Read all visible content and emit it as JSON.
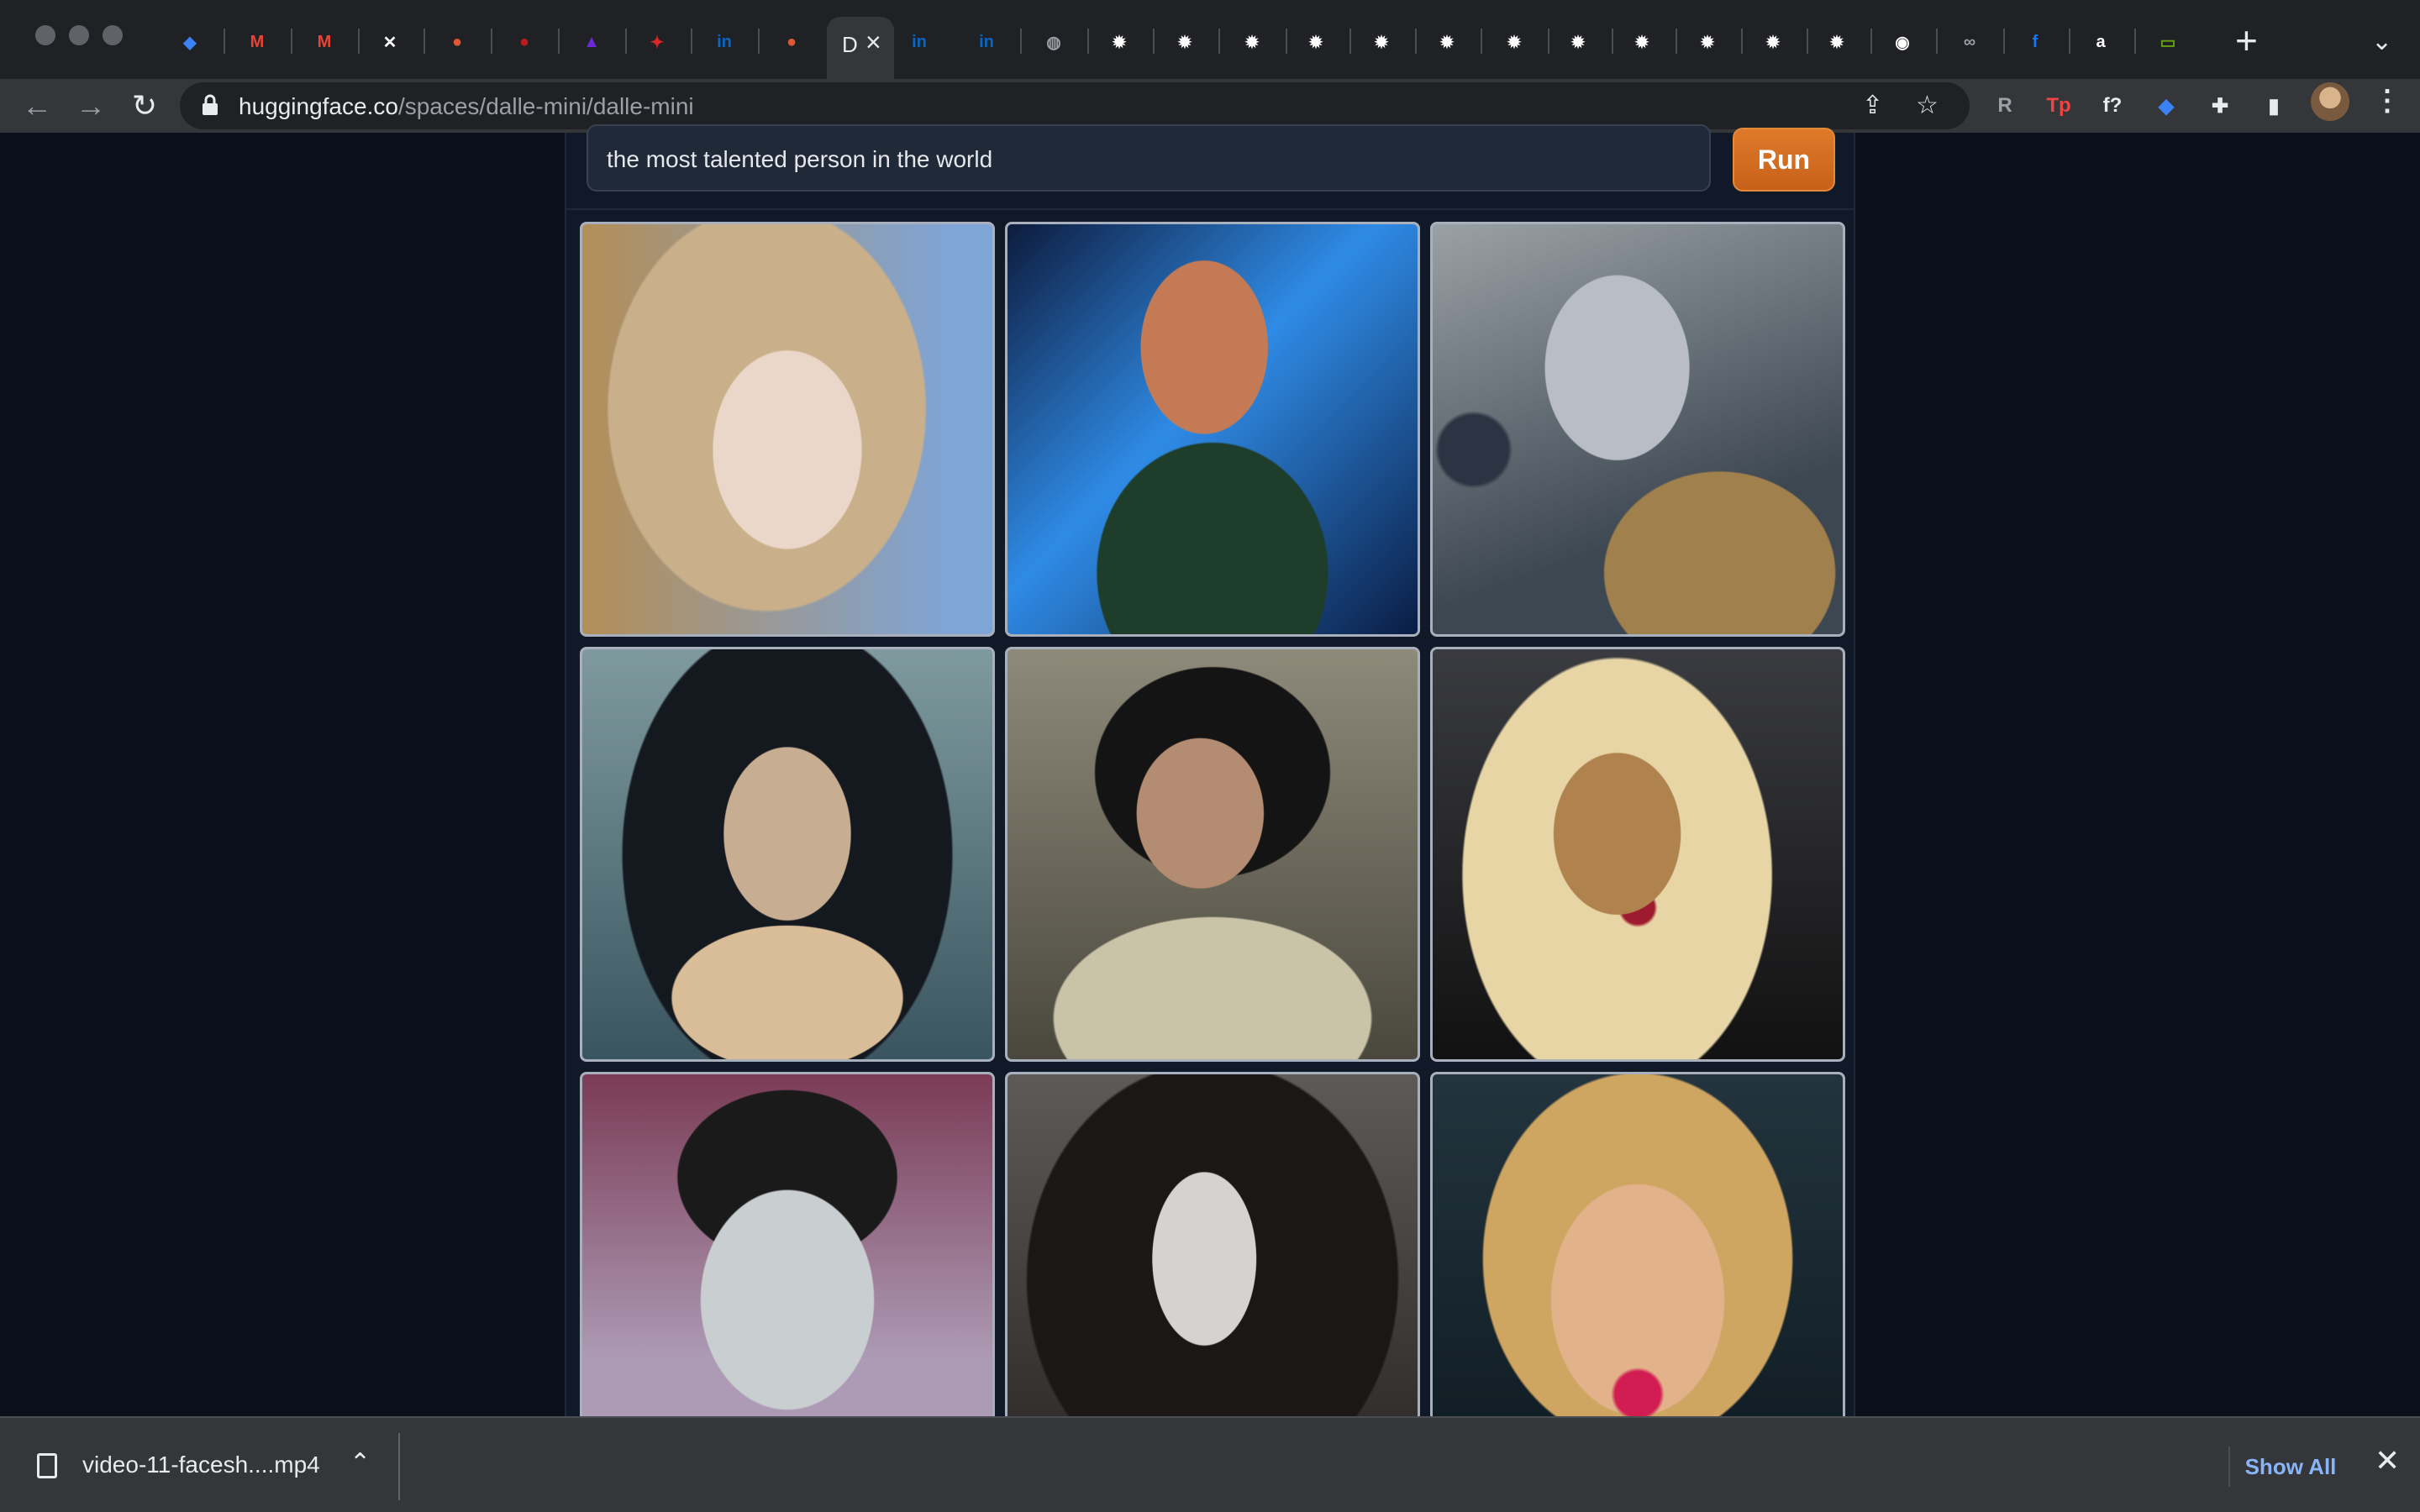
{
  "browser": {
    "url_host": "huggingface.co",
    "url_path": "/spaces/dalle-mini/dalle-mini",
    "active_tab_glyph": "D",
    "tabs": [
      {
        "icon": "gem-icon",
        "glyph": "◆",
        "color": "#3b82f6"
      },
      {
        "icon": "gmail-icon",
        "glyph": "M",
        "color": "#ea4335"
      },
      {
        "icon": "gmail-icon",
        "glyph": "M",
        "color": "#ea4335"
      },
      {
        "icon": "app-icon",
        "glyph": "✕",
        "color": "#ffffff"
      },
      {
        "icon": "duckduckgo-icon",
        "glyph": "●",
        "color": "#de5833"
      },
      {
        "icon": "record-icon",
        "glyph": "●",
        "color": "#b91c1c"
      },
      {
        "icon": "purple-app-icon",
        "glyph": "▲",
        "color": "#6d28d9"
      },
      {
        "icon": "red-app-icon",
        "glyph": "✦",
        "color": "#dc2626"
      },
      {
        "icon": "linkedin-icon",
        "glyph": "in",
        "color": "#0a66c2"
      },
      {
        "icon": "duckduckgo-icon",
        "glyph": "●",
        "color": "#de5833"
      },
      {
        "icon": "linkedin-icon",
        "glyph": "in",
        "color": "#0a66c2"
      },
      {
        "icon": "linkedin-icon",
        "glyph": "in",
        "color": "#0a66c2"
      },
      {
        "icon": "globe-icon",
        "glyph": "◍",
        "color": "#9aa0a6"
      },
      {
        "icon": "gear-icon",
        "glyph": "✹",
        "color": "#ffffff"
      },
      {
        "icon": "gear-icon",
        "glyph": "✹",
        "color": "#ffffff"
      },
      {
        "icon": "gear-icon",
        "glyph": "✹",
        "color": "#ffffff"
      },
      {
        "icon": "gear-icon",
        "glyph": "✹",
        "color": "#ffffff"
      },
      {
        "icon": "gear-icon",
        "glyph": "✹",
        "color": "#ffffff"
      },
      {
        "icon": "gear-icon",
        "glyph": "✹",
        "color": "#ffffff"
      },
      {
        "icon": "gear-icon",
        "glyph": "✹",
        "color": "#ffffff"
      },
      {
        "icon": "gear-icon",
        "glyph": "✹",
        "color": "#ffffff"
      },
      {
        "icon": "gear-icon",
        "glyph": "✹",
        "color": "#ffffff"
      },
      {
        "icon": "gear-icon",
        "glyph": "✹",
        "color": "#ffffff"
      },
      {
        "icon": "gear-icon",
        "glyph": "✹",
        "color": "#ffffff"
      },
      {
        "icon": "gear-icon",
        "glyph": "✹",
        "color": "#ffffff"
      },
      {
        "icon": "github-icon",
        "glyph": "◉",
        "color": "#ffffff"
      },
      {
        "icon": "infinity-icon",
        "glyph": "∞",
        "color": "#9aa0a6"
      },
      {
        "icon": "facebook-icon",
        "glyph": "f",
        "color": "#1877f2"
      },
      {
        "icon": "amazon-icon",
        "glyph": "a",
        "color": "#ffffff"
      },
      {
        "icon": "battery-icon",
        "glyph": "▭",
        "color": "#65a30d"
      }
    ],
    "extensions": [
      {
        "icon": "r-extension-icon",
        "glyph": "R",
        "color": "#9aa0a6"
      },
      {
        "icon": "tp-extension-icon",
        "glyph": "Tp",
        "color": "#ef4444"
      },
      {
        "icon": "formula-extension-icon",
        "glyph": "f?",
        "color": "#e8eaed"
      },
      {
        "icon": "gem-extension-icon",
        "glyph": "◆",
        "color": "#3b82f6"
      },
      {
        "icon": "puzzle-icon",
        "glyph": "✚",
        "color": "#e8eaed"
      },
      {
        "icon": "sidepanel-icon",
        "glyph": "▮",
        "color": "#e8eaed"
      }
    ]
  },
  "app": {
    "prompt_value": "the most talented person in the world",
    "run_label": "Run",
    "images": [
      "generated-image-1",
      "generated-image-2",
      "generated-image-3",
      "generated-image-4",
      "generated-image-5",
      "generated-image-6",
      "generated-image-7",
      "generated-image-8",
      "generated-image-9"
    ]
  },
  "download": {
    "filename": "video-11-facesh....mp4",
    "show_all": "Show All"
  }
}
